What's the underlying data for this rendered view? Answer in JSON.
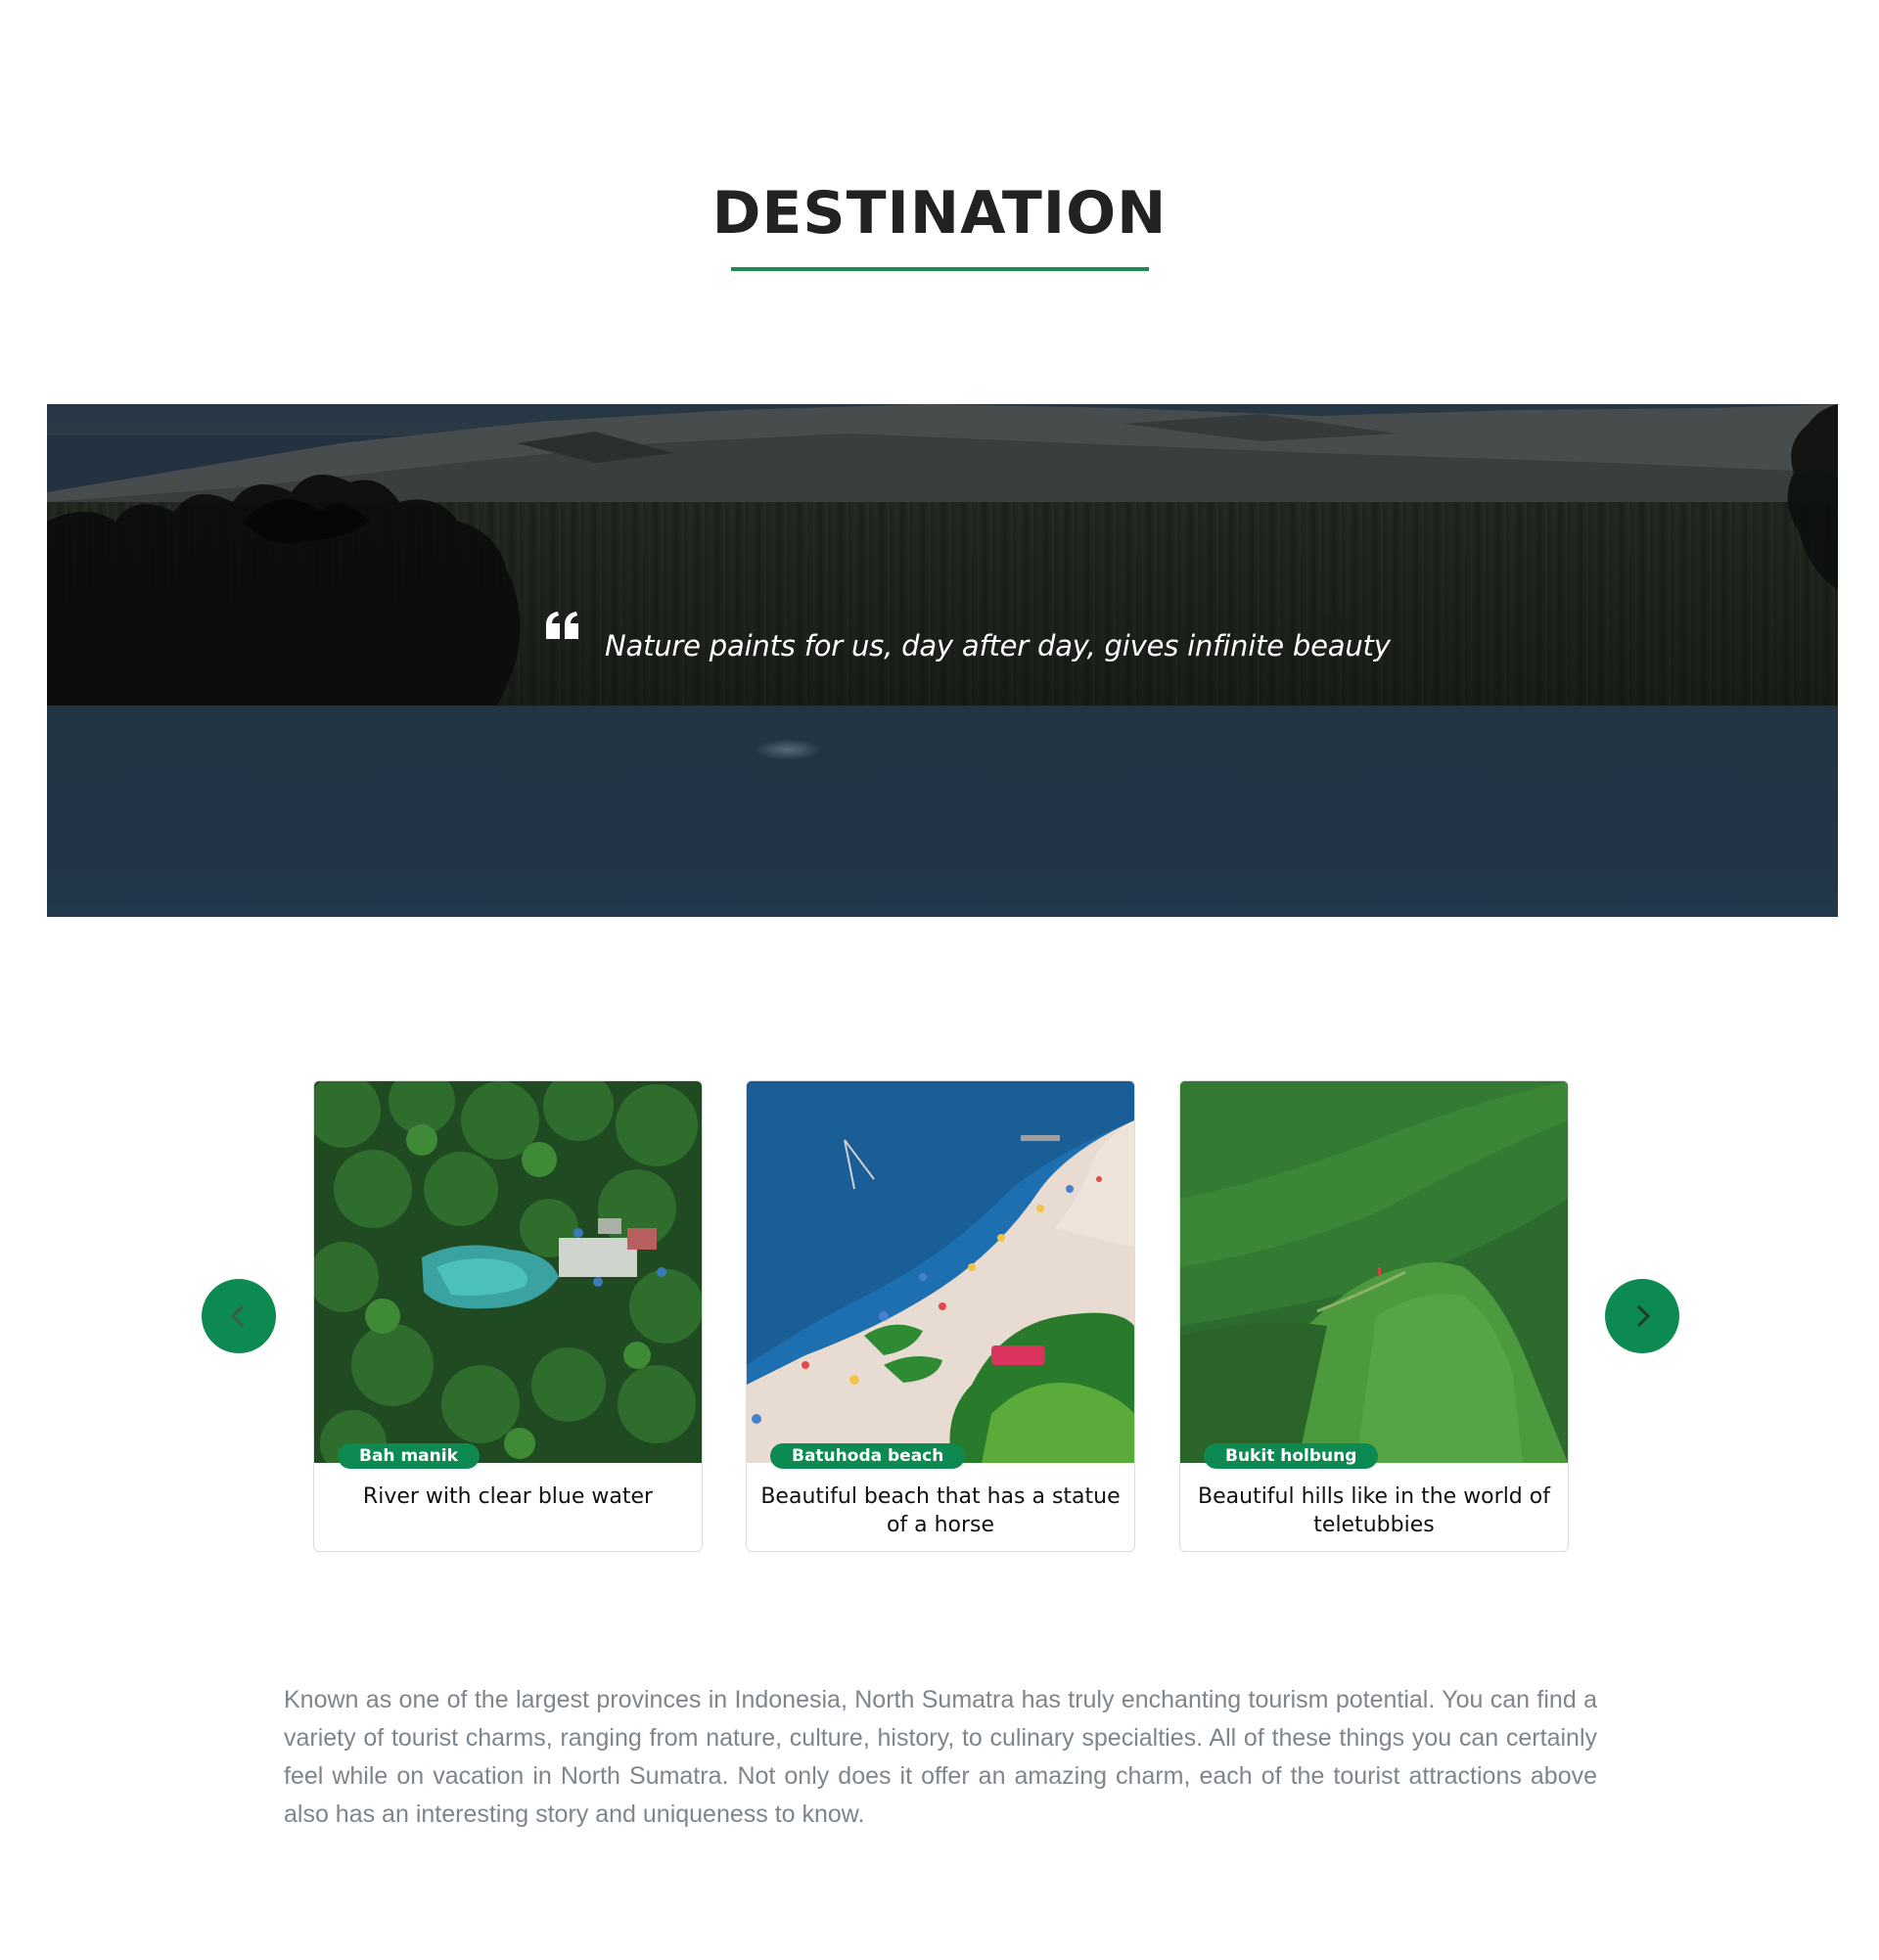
{
  "section": {
    "title": "DESTINATION"
  },
  "hero": {
    "quote": "Nature paints for us, day after day, gives infinite beauty"
  },
  "carousel": {
    "prev_icon": "chevron-left-icon",
    "next_icon": "chevron-right-icon",
    "cards": [
      {
        "tag": "Bah manik",
        "description": "River with clear blue water"
      },
      {
        "tag": "Batuhoda beach",
        "description": "Beautiful beach that has a statue of a horse"
      },
      {
        "tag": "Bukit holbung",
        "description": "Beautiful hills like in the world of teletubbies"
      }
    ]
  },
  "about": {
    "text": "Known as one of the largest provinces in Indonesia, North Sumatra has truly enchanting tourism potential. You can find a variety of tourist charms, ranging from nature, culture, history, to culinary specialties. All of these things you can certainly feel while on vacation in North Sumatra. Not only does it offer an amazing charm, each of the tourist attractions above also has an interesting story and uniqueness to know."
  },
  "colors": {
    "accent": "#0d8a52",
    "title": "#222222",
    "body_text": "#7d858d"
  }
}
